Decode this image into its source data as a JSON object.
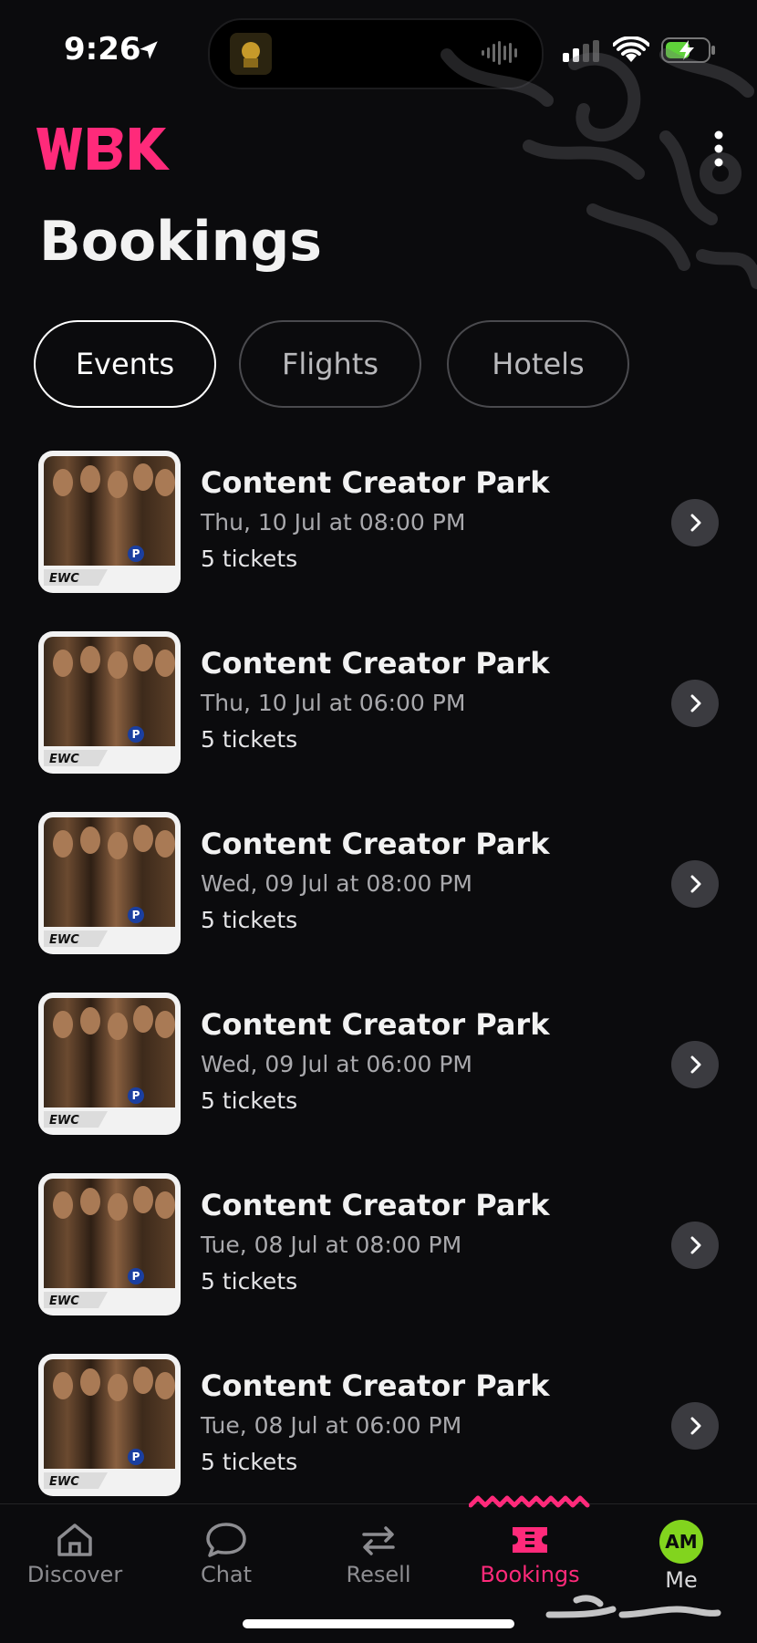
{
  "status_bar": {
    "time": "9:26"
  },
  "header": {
    "page_title": "Bookings"
  },
  "tabs": [
    {
      "label": "Events",
      "active": true
    },
    {
      "label": "Flights",
      "active": false
    },
    {
      "label": "Hotels",
      "active": false
    }
  ],
  "bookings": [
    {
      "title": "Content Creator Park",
      "date": "Thu, 10 Jul at 08:00 PM",
      "tickets": "5 tickets"
    },
    {
      "title": "Content Creator Park",
      "date": "Thu, 10 Jul at 06:00 PM",
      "tickets": "5 tickets"
    },
    {
      "title": "Content Creator Park",
      "date": "Wed, 09 Jul at 08:00 PM",
      "tickets": "5 tickets"
    },
    {
      "title": "Content Creator Park",
      "date": "Wed, 09 Jul at 06:00 PM",
      "tickets": "5 tickets"
    },
    {
      "title": "Content Creator Park",
      "date": "Tue, 08 Jul at 08:00 PM",
      "tickets": "5 tickets"
    },
    {
      "title": "Content Creator Park",
      "date": "Tue, 08 Jul at 06:00 PM",
      "tickets": "5 tickets"
    }
  ],
  "bottom_nav": [
    {
      "label": "Discover",
      "icon": "home-icon",
      "active": false
    },
    {
      "label": "Chat",
      "icon": "chat-bubble-icon",
      "active": false
    },
    {
      "label": "Resell",
      "icon": "swap-arrows-icon",
      "active": false
    },
    {
      "label": "Bookings",
      "icon": "ticket-icon",
      "active": true
    },
    {
      "label": "Me",
      "icon": "avatar",
      "active": false
    }
  ],
  "avatar_initials": "AM",
  "colors": {
    "accent": "#ff2a7a",
    "background": "#0b0b0d",
    "avatar": "#82d41e"
  }
}
